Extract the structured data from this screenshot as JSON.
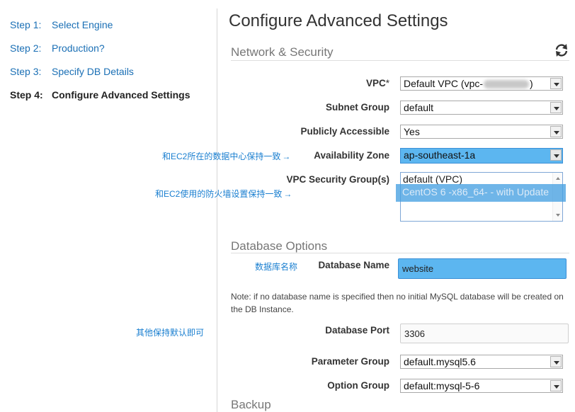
{
  "sidebar": {
    "steps": [
      {
        "num": "Step 1:",
        "label": "Select Engine"
      },
      {
        "num": "Step 2:",
        "label": "Production?"
      },
      {
        "num": "Step 3:",
        "label": "Specify DB Details"
      },
      {
        "num": "Step 4:",
        "label": "Configure Advanced Settings"
      }
    ]
  },
  "main": {
    "title": "Configure Advanced Settings",
    "sections": {
      "network": "Network & Security",
      "database": "Database Options",
      "backup": "Backup"
    },
    "icons": {
      "refresh": "refresh-icon"
    },
    "fields": {
      "vpc": {
        "label": "VPC",
        "required_mark": "*",
        "value_prefix": "Default VPC (vpc-",
        "value_suffix": ")"
      },
      "subnet_group": {
        "label": "Subnet Group",
        "value": "default"
      },
      "publicly_accessible": {
        "label": "Publicly Accessible",
        "value": "Yes"
      },
      "availability_zone": {
        "label": "Availability Zone",
        "value": "ap-southeast-1a"
      },
      "vpc_security_groups": {
        "label": "VPC Security Group(s)",
        "options": [
          "default (VPC)",
          "CentOS 6 -x86_64- - with Update"
        ]
      },
      "database_name": {
        "label": "Database Name",
        "value": "website"
      },
      "note": "Note: if no database name is specified then no initial MySQL database will be created on the DB Instance.",
      "database_port": {
        "label": "Database Port",
        "value": "3306"
      },
      "parameter_group": {
        "label": "Parameter Group",
        "value": "default.mysql5.6"
      },
      "option_group": {
        "label": "Option Group",
        "value": "default:mysql-5-6"
      }
    }
  },
  "annotations": {
    "az": "和EC2所在的数据中心保持一致",
    "sg": "和EC2使用的防火墙设置保持一致",
    "dbname": "数据库名称",
    "others": "其他保持默认即可",
    "arrow": "→"
  },
  "colors": {
    "link": "#1a6fb5",
    "highlight": "#5cb6f0",
    "annotation": "#1a7fd0"
  }
}
